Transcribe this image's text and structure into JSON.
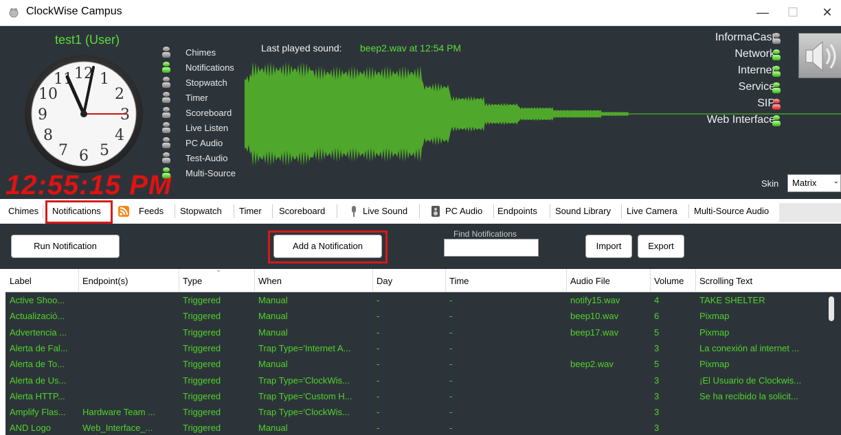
{
  "window": {
    "title": "ClockWise Campus",
    "minimize": "—",
    "maximize": "☐",
    "close": "✕"
  },
  "header": {
    "user": "test1 (User)",
    "digital_time": "12:55:15 PM",
    "clock_numbers": [
      "12",
      "1",
      "2",
      "3",
      "4",
      "5",
      "6",
      "7",
      "8",
      "9",
      "10",
      "11"
    ],
    "modules": [
      {
        "label": "Chimes",
        "state": "gray"
      },
      {
        "label": "Notifications",
        "state": "green"
      },
      {
        "label": "Stopwatch",
        "state": "gray"
      },
      {
        "label": "Timer",
        "state": "gray"
      },
      {
        "label": "Scoreboard",
        "state": "gray"
      },
      {
        "label": "Live Listen",
        "state": "gray"
      },
      {
        "label": "PC Audio",
        "state": "gray"
      },
      {
        "label": "Test-Audio",
        "state": "gray"
      },
      {
        "label": "Multi-Source",
        "state": "green"
      }
    ],
    "last_played_label": "Last played sound:",
    "last_played_value": "beep2.wav at 12:54 PM",
    "statuses": [
      {
        "label": "InformaCast",
        "state": "gray"
      },
      {
        "label": "Network",
        "state": "green"
      },
      {
        "label": "Internet",
        "state": "green"
      },
      {
        "label": "Service",
        "state": "green"
      },
      {
        "label": "SIP",
        "state": "red"
      },
      {
        "label": "Web Interface",
        "state": "green"
      }
    ],
    "skin_label": "Skin",
    "skin_value": "Matrix"
  },
  "tabs": [
    "Chimes",
    "Notifications",
    "Feeds",
    "Stopwatch",
    "Timer",
    "Scoreboard",
    "Live Sound",
    "PC Audio",
    "Endpoints",
    "Sound Library",
    "Live Camera",
    "Multi-Source Audio"
  ],
  "active_tab": "Notifications",
  "toolbar": {
    "run_label": "Run Notification",
    "add_label": "Add a Notification",
    "find_label": "Find Notifications",
    "find_value": "",
    "import_label": "Import",
    "export_label": "Export"
  },
  "table": {
    "columns": [
      "Label",
      "Endpoint(s)",
      "Type",
      "When",
      "Day",
      "Time",
      "Audio File",
      "Volume",
      "Scrolling Text"
    ],
    "rows": [
      [
        "Active Shoo...",
        "",
        "Triggered",
        "Manual",
        "-",
        "-",
        "notify15.wav",
        "4",
        "TAKE SHELTER"
      ],
      [
        "Actualizació...",
        "",
        "Triggered",
        "Manual",
        "-",
        "-",
        "beep10.wav",
        "6",
        "Pixmap"
      ],
      [
        "Advertencia ...",
        "",
        "Triggered",
        "Manual",
        "-",
        "-",
        "beep17.wav",
        "5",
        "Pixmap"
      ],
      [
        "Alerta de Fal...",
        "",
        "Triggered",
        "Trap Type='Internet A...",
        "-",
        "-",
        "",
        "3",
        "La conexión al internet ..."
      ],
      [
        "Alerta de To...",
        "",
        "Triggered",
        "Manual",
        "-",
        "-",
        "beep2.wav",
        "5",
        "Pixmap"
      ],
      [
        "Alerta de Us...",
        "",
        "Triggered",
        "Trap Type='ClockWis...",
        "-",
        "-",
        "",
        "3",
        "¡El Usuario de Clockwis..."
      ],
      [
        "Alerta HTTP...",
        "",
        "Triggered",
        "Trap Type='Custom H...",
        "-",
        "-",
        "",
        "3",
        "Se ha recibido la solicit..."
      ],
      [
        "Amplify Flas...",
        "Hardware Team ...",
        "Triggered",
        "Trap Type='ClockWis...",
        "-",
        "-",
        "",
        "3",
        ""
      ],
      [
        "AND Logo",
        "Web_Interface_...",
        "Triggered",
        "Manual",
        "-",
        "-",
        "",
        "3",
        ""
      ]
    ]
  },
  "colors": {
    "green": "#4fd32c",
    "panel": "#2d3439",
    "highlight": "#d51a1a",
    "digital": "#e01212"
  }
}
